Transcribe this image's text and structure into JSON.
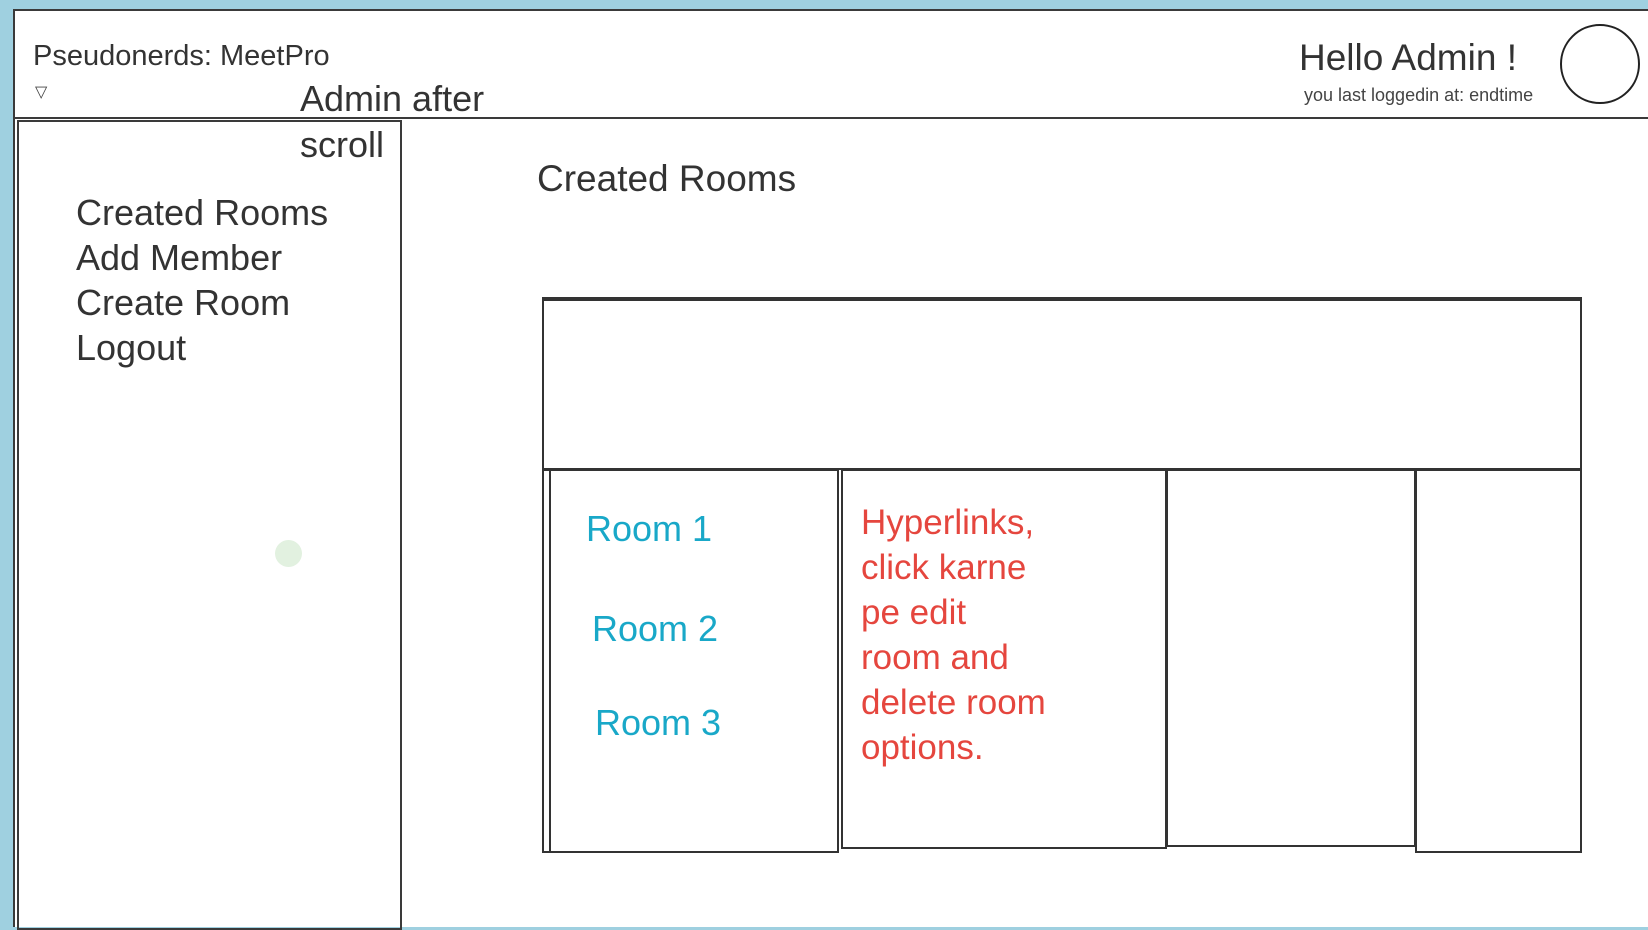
{
  "header": {
    "app_title": "Pseudonerds: MeetPro",
    "dropdown_icon": "triangle-down-icon",
    "admin_note_line1": "Admin after",
    "admin_note_line2": "scroll",
    "greeting": "Hello Admin !",
    "last_login": "you last loggedin at: endtime",
    "avatar_icon": "avatar-circle-icon"
  },
  "sidebar": {
    "items": [
      {
        "label": "Created Rooms"
      },
      {
        "label": "Add Member"
      },
      {
        "label": "Create Room"
      },
      {
        "label": "Logout"
      }
    ]
  },
  "main": {
    "title": "Created Rooms",
    "rooms": [
      {
        "label": "Room 1"
      },
      {
        "label": "Room 2"
      },
      {
        "label": "Room 3"
      }
    ],
    "note_lines": [
      "Hyperlinks,",
      "click karne",
      "pe edit",
      "room and",
      "delete room",
      "options."
    ]
  },
  "colors": {
    "background": "#9fd0e0",
    "link": "#19a8c8",
    "annotation": "#e5463e",
    "border": "#333333"
  }
}
